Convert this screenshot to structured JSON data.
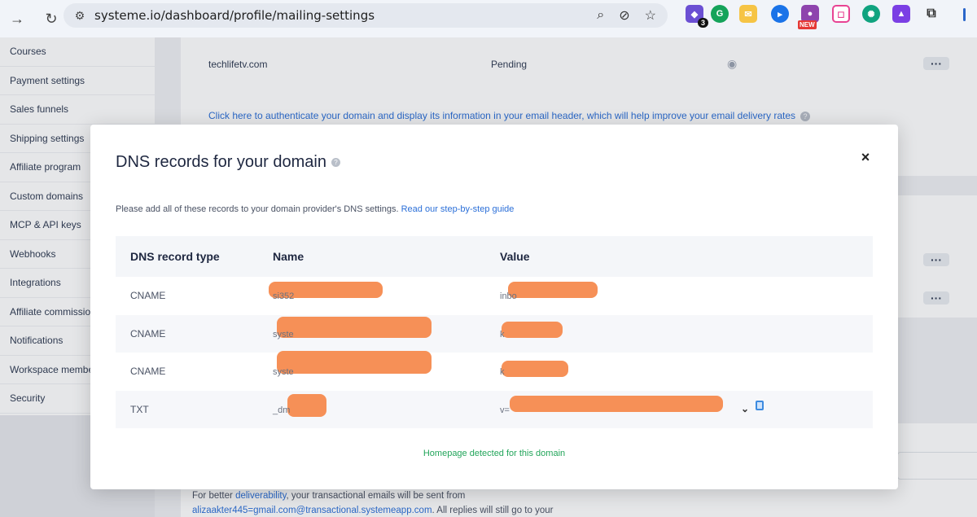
{
  "browser": {
    "url": "systeme.io/dashboard/profile/mailing-settings",
    "ext_badge": "3",
    "ext_new": "NEW"
  },
  "sidebar": {
    "items": [
      {
        "label": "Courses"
      },
      {
        "label": "Payment settings"
      },
      {
        "label": "Sales funnels"
      },
      {
        "label": "Shipping settings"
      },
      {
        "label": "Affiliate program"
      },
      {
        "label": "Custom domains"
      },
      {
        "label": "MCP & API keys"
      },
      {
        "label": "Webhooks"
      },
      {
        "label": "Integrations"
      },
      {
        "label": "Affiliate commissions"
      },
      {
        "label": "Notifications"
      },
      {
        "label": "Workspace members"
      },
      {
        "label": "Security"
      }
    ]
  },
  "main": {
    "domain": "techlifetv.com",
    "status": "Pending",
    "auth_link": "Click here to authenticate your domain and display its information in your email header, which will help improve your email delivery rates",
    "bottom_prefix": "For better ",
    "bottom_link": "deliverability",
    "bottom_mid": ", your transactional emails will be sent from",
    "bottom_email": "alizaakter445=gmail.com@transactional.systemeapp.com",
    "bottom_suffix": ". All replies will still go to your"
  },
  "modal": {
    "title": "DNS records for your domain",
    "intro": "Please add all of these records to your domain provider's DNS settings. ",
    "intro_link": "Read our step-by-step guide",
    "columns": [
      "DNS record type",
      "Name",
      "Value"
    ],
    "rows": [
      {
        "type": "CNAME",
        "name": "si352",
        "value": "inbo"
      },
      {
        "type": "CNAME",
        "name": "syste",
        "value": "k"
      },
      {
        "type": "CNAME",
        "name": "syste",
        "value": "k"
      },
      {
        "type": "TXT",
        "name": "_dm",
        "value": "v="
      }
    ],
    "footer": "Homepage detected for this domain",
    "close": "×"
  },
  "colors": {
    "accent": "#2b6fd8",
    "success": "#22a55a",
    "redaction": "#f58a4e"
  }
}
